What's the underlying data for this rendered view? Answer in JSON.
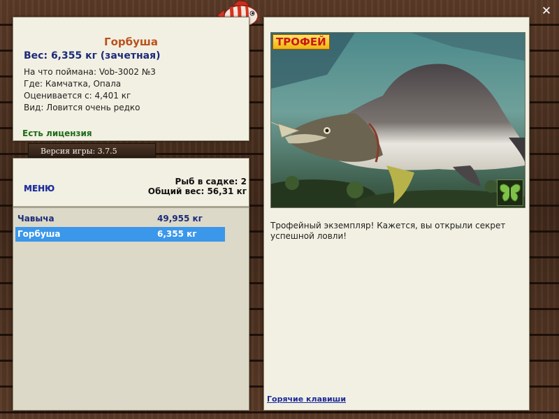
{
  "catch_info": {
    "title": "Горбуша",
    "weight": "Вес: 6,355 кг (зачетная)",
    "caught_on": "На что поймана: Vob-3002 №3",
    "where": "Где: Камчатка, Опала",
    "valued_from": "Оценивается с: 4,401 кг",
    "kind": "Вид: Ловится очень редко",
    "license": "Есть лицензия"
  },
  "version": "Версия игры: 3.7.5",
  "list_panel": {
    "menu_label": "МЕНЮ",
    "fish_count": "Рыб в садке: 2",
    "total_weight": "Общий вес: 56,31 кг",
    "catches": [
      {
        "name": "Чавыча",
        "weight": "49,955 кг",
        "selected": false
      },
      {
        "name": "Горбуша",
        "weight": "6,355 кг",
        "selected": true
      }
    ]
  },
  "detail": {
    "trophy_label": "ТРОФЕЙ",
    "description": "Трофейный экземпляр! Кажется, вы открыли секрет успешной ловли!",
    "hotkeys_label": "Горячие клавиши"
  },
  "icons": {
    "close": "close-icon",
    "logo": "fish-logo-icon",
    "butterfly": "butterfly-icon"
  },
  "colors": {
    "title": "#b9521d",
    "weight": "#1b2a7a",
    "license": "#1e6b1a",
    "selection": "#3b97ea",
    "link": "#1b2a9a"
  }
}
